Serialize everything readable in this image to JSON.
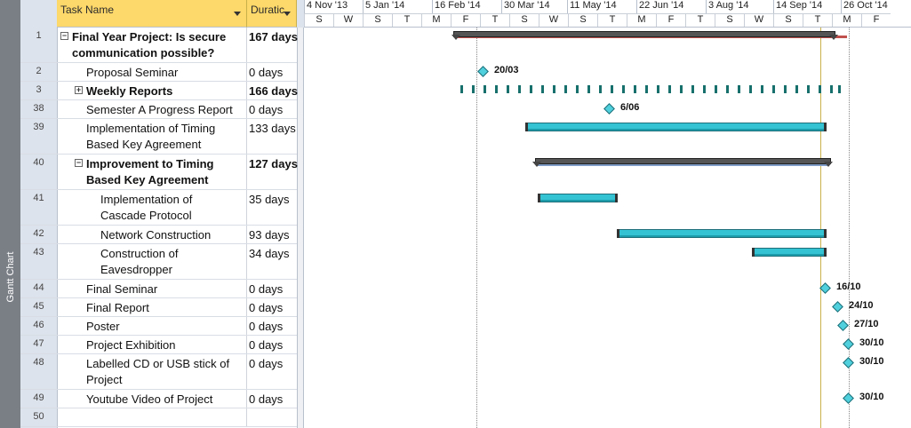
{
  "side_label": "Gantt Chart",
  "header": {
    "task_name": "Task Name",
    "duration": "Duratic"
  },
  "timescale": {
    "top": [
      "4 Nov '13",
      "5 Jan '14",
      "16 Feb '14",
      "30 Mar '14",
      "11 May '14",
      "22 Jun '14",
      "3 Aug '14",
      "14 Sep '14",
      "26 Oct '14"
    ],
    "bottom": [
      "S",
      "W",
      "S",
      "T",
      "M",
      "F",
      "T",
      "S",
      "W",
      "S",
      "T",
      "M",
      "F",
      "T",
      "S",
      "W",
      "S",
      "T",
      "M",
      "F"
    ]
  },
  "rows": [
    {
      "id": "1",
      "name_line1": "Final Year Project: Is secure",
      "name_line2": "communication possible?",
      "duration": "167 days"
    },
    {
      "id": "2",
      "name_line1": "Proposal Seminar",
      "name_line2": "",
      "duration": "0 days"
    },
    {
      "id": "3",
      "name_line1": "Weekly Reports",
      "name_line2": "",
      "duration": "166 days"
    },
    {
      "id": "38",
      "name_line1": "Semester A Progress Report",
      "name_line2": "",
      "duration": "0 days"
    },
    {
      "id": "39",
      "name_line1": "Implementation of Timing",
      "name_line2": "Based Key Agreement",
      "duration": "133 days"
    },
    {
      "id": "40",
      "name_line1": "Improvement to Timing",
      "name_line2": "Based Key Agreement",
      "duration": "127 days"
    },
    {
      "id": "41",
      "name_line1": "Implementation of",
      "name_line2": "Cascade Protocol",
      "duration": "35 days"
    },
    {
      "id": "42",
      "name_line1": "Network Construction",
      "name_line2": "",
      "duration": "93 days"
    },
    {
      "id": "43",
      "name_line1": "Construction of",
      "name_line2": "Eavesdropper",
      "duration": "34 days"
    },
    {
      "id": "44",
      "name_line1": "Final Seminar",
      "name_line2": "",
      "duration": "0 days"
    },
    {
      "id": "45",
      "name_line1": "Final Report",
      "name_line2": "",
      "duration": "0 days"
    },
    {
      "id": "46",
      "name_line1": "Poster",
      "name_line2": "",
      "duration": "0 days"
    },
    {
      "id": "47",
      "name_line1": "Project Exhibition",
      "name_line2": "",
      "duration": "0 days"
    },
    {
      "id": "48",
      "name_line1": "Labelled CD or USB stick of",
      "name_line2": "Project",
      "duration": "0 days"
    },
    {
      "id": "49",
      "name_line1": "Youtube Video of Project",
      "name_line2": "",
      "duration": "0 days"
    },
    {
      "id": "50",
      "name_line1": "",
      "name_line2": "",
      "duration": ""
    }
  ],
  "toggles": {
    "row1": "−",
    "row3": "+",
    "row40": "−"
  },
  "milestones": {
    "proposal_seminar": "20/03",
    "semester_a_report": "6/06",
    "final_seminar": "16/10",
    "final_report": "24/10",
    "poster": "27/10",
    "project_exhibition": "30/10",
    "labelled_cd": "30/10",
    "youtube_video": "30/10"
  },
  "colors": {
    "header": "#fdd86a",
    "task_bar": "#34c3d3",
    "summary_bar": "#555555",
    "project_bar": "#c0504d",
    "milestone": "#4fd0dc",
    "status_line": "#c9b14b"
  }
}
